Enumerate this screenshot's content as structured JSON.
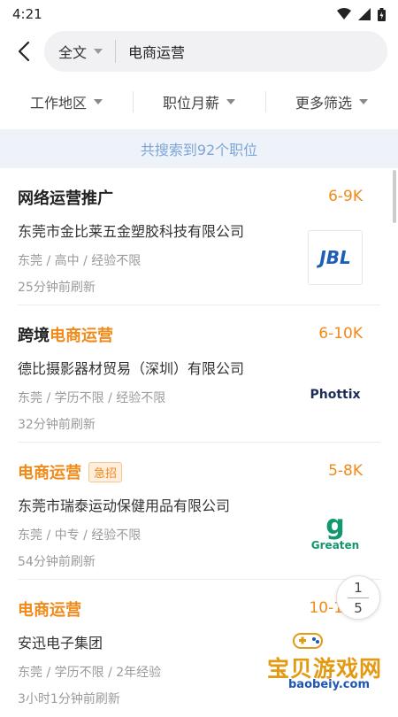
{
  "status": {
    "time": "4:21"
  },
  "search": {
    "scope": "全文",
    "query": "电商运营"
  },
  "filters": [
    "工作地区",
    "职位月薪",
    "更多筛选"
  ],
  "result_count": "共搜索到92个职位",
  "jobs": [
    {
      "title_prefix": "网络运营推广",
      "title_highlight": "",
      "tag": "",
      "salary": "6-9K",
      "company": "东莞市金比莱五金塑胶科技有限公司",
      "meta": "东莞 / 高中 / 经验不限",
      "refreshed": "25分钟前刷新",
      "logo_text": "JBL"
    },
    {
      "title_prefix": "跨境",
      "title_highlight": "电商运营",
      "tag": "",
      "salary": "6-10K",
      "company": "德比摄影器材贸易（深圳）有限公司",
      "meta": "东莞 / 学历不限 / 经验不限",
      "refreshed": "32分钟前刷新",
      "logo_text": "Phottix"
    },
    {
      "title_prefix": "",
      "title_highlight": "电商运营",
      "tag": "急招",
      "salary": "5-8K",
      "company": "东莞市瑞泰运动保健用品有限公司",
      "meta": "东莞 / 中专 / 经验不限",
      "refreshed": "54分钟前刷新",
      "logo_text": "Greaten"
    },
    {
      "title_prefix": "",
      "title_highlight": "电商运营",
      "tag": "",
      "salary": "10-15K",
      "company": "安迅电子集团",
      "meta": "东莞 / 学历不限 / 2年经验",
      "refreshed": "3小时1分钟前刷新",
      "logo_text": ""
    }
  ],
  "pager": {
    "current": "1",
    "total": "5"
  },
  "watermark": {
    "title": "宝贝游戏网",
    "url": "baobeiy.com"
  },
  "colors": {
    "accent": "#f08a1a",
    "count_bg": "#eef3fa",
    "count_text": "#7fa4d6"
  }
}
